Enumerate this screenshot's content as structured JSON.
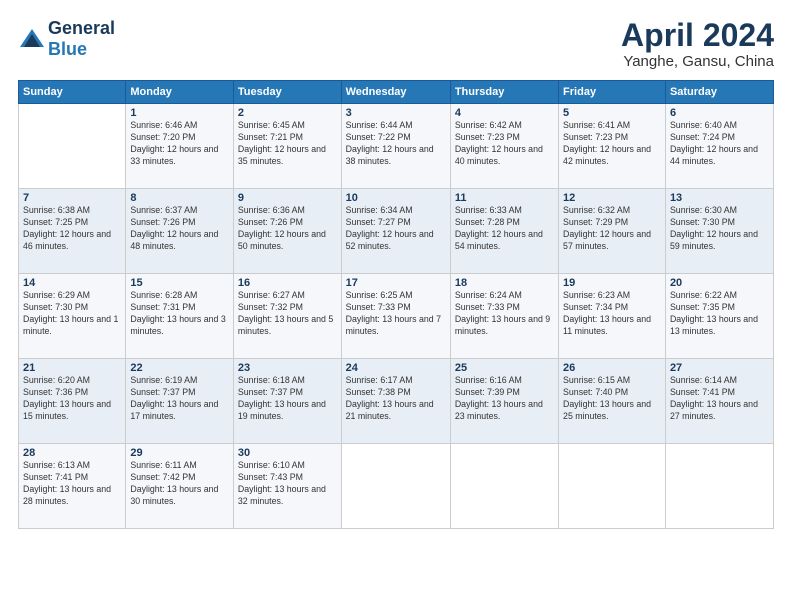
{
  "header": {
    "logo": {
      "general": "General",
      "blue": "Blue"
    },
    "title": "April 2024",
    "location": "Yanghe, Gansu, China"
  },
  "calendar": {
    "days_of_week": [
      "Sunday",
      "Monday",
      "Tuesday",
      "Wednesday",
      "Thursday",
      "Friday",
      "Saturday"
    ],
    "weeks": [
      [
        {
          "day": "",
          "sunrise": "",
          "sunset": "",
          "daylight": ""
        },
        {
          "day": "1",
          "sunrise": "Sunrise: 6:46 AM",
          "sunset": "Sunset: 7:20 PM",
          "daylight": "Daylight: 12 hours and 33 minutes."
        },
        {
          "day": "2",
          "sunrise": "Sunrise: 6:45 AM",
          "sunset": "Sunset: 7:21 PM",
          "daylight": "Daylight: 12 hours and 35 minutes."
        },
        {
          "day": "3",
          "sunrise": "Sunrise: 6:44 AM",
          "sunset": "Sunset: 7:22 PM",
          "daylight": "Daylight: 12 hours and 38 minutes."
        },
        {
          "day": "4",
          "sunrise": "Sunrise: 6:42 AM",
          "sunset": "Sunset: 7:23 PM",
          "daylight": "Daylight: 12 hours and 40 minutes."
        },
        {
          "day": "5",
          "sunrise": "Sunrise: 6:41 AM",
          "sunset": "Sunset: 7:23 PM",
          "daylight": "Daylight: 12 hours and 42 minutes."
        },
        {
          "day": "6",
          "sunrise": "Sunrise: 6:40 AM",
          "sunset": "Sunset: 7:24 PM",
          "daylight": "Daylight: 12 hours and 44 minutes."
        }
      ],
      [
        {
          "day": "7",
          "sunrise": "Sunrise: 6:38 AM",
          "sunset": "Sunset: 7:25 PM",
          "daylight": "Daylight: 12 hours and 46 minutes."
        },
        {
          "day": "8",
          "sunrise": "Sunrise: 6:37 AM",
          "sunset": "Sunset: 7:26 PM",
          "daylight": "Daylight: 12 hours and 48 minutes."
        },
        {
          "day": "9",
          "sunrise": "Sunrise: 6:36 AM",
          "sunset": "Sunset: 7:26 PM",
          "daylight": "Daylight: 12 hours and 50 minutes."
        },
        {
          "day": "10",
          "sunrise": "Sunrise: 6:34 AM",
          "sunset": "Sunset: 7:27 PM",
          "daylight": "Daylight: 12 hours and 52 minutes."
        },
        {
          "day": "11",
          "sunrise": "Sunrise: 6:33 AM",
          "sunset": "Sunset: 7:28 PM",
          "daylight": "Daylight: 12 hours and 54 minutes."
        },
        {
          "day": "12",
          "sunrise": "Sunrise: 6:32 AM",
          "sunset": "Sunset: 7:29 PM",
          "daylight": "Daylight: 12 hours and 57 minutes."
        },
        {
          "day": "13",
          "sunrise": "Sunrise: 6:30 AM",
          "sunset": "Sunset: 7:30 PM",
          "daylight": "Daylight: 12 hours and 59 minutes."
        }
      ],
      [
        {
          "day": "14",
          "sunrise": "Sunrise: 6:29 AM",
          "sunset": "Sunset: 7:30 PM",
          "daylight": "Daylight: 13 hours and 1 minute."
        },
        {
          "day": "15",
          "sunrise": "Sunrise: 6:28 AM",
          "sunset": "Sunset: 7:31 PM",
          "daylight": "Daylight: 13 hours and 3 minutes."
        },
        {
          "day": "16",
          "sunrise": "Sunrise: 6:27 AM",
          "sunset": "Sunset: 7:32 PM",
          "daylight": "Daylight: 13 hours and 5 minutes."
        },
        {
          "day": "17",
          "sunrise": "Sunrise: 6:25 AM",
          "sunset": "Sunset: 7:33 PM",
          "daylight": "Daylight: 13 hours and 7 minutes."
        },
        {
          "day": "18",
          "sunrise": "Sunrise: 6:24 AM",
          "sunset": "Sunset: 7:33 PM",
          "daylight": "Daylight: 13 hours and 9 minutes."
        },
        {
          "day": "19",
          "sunrise": "Sunrise: 6:23 AM",
          "sunset": "Sunset: 7:34 PM",
          "daylight": "Daylight: 13 hours and 11 minutes."
        },
        {
          "day": "20",
          "sunrise": "Sunrise: 6:22 AM",
          "sunset": "Sunset: 7:35 PM",
          "daylight": "Daylight: 13 hours and 13 minutes."
        }
      ],
      [
        {
          "day": "21",
          "sunrise": "Sunrise: 6:20 AM",
          "sunset": "Sunset: 7:36 PM",
          "daylight": "Daylight: 13 hours and 15 minutes."
        },
        {
          "day": "22",
          "sunrise": "Sunrise: 6:19 AM",
          "sunset": "Sunset: 7:37 PM",
          "daylight": "Daylight: 13 hours and 17 minutes."
        },
        {
          "day": "23",
          "sunrise": "Sunrise: 6:18 AM",
          "sunset": "Sunset: 7:37 PM",
          "daylight": "Daylight: 13 hours and 19 minutes."
        },
        {
          "day": "24",
          "sunrise": "Sunrise: 6:17 AM",
          "sunset": "Sunset: 7:38 PM",
          "daylight": "Daylight: 13 hours and 21 minutes."
        },
        {
          "day": "25",
          "sunrise": "Sunrise: 6:16 AM",
          "sunset": "Sunset: 7:39 PM",
          "daylight": "Daylight: 13 hours and 23 minutes."
        },
        {
          "day": "26",
          "sunrise": "Sunrise: 6:15 AM",
          "sunset": "Sunset: 7:40 PM",
          "daylight": "Daylight: 13 hours and 25 minutes."
        },
        {
          "day": "27",
          "sunrise": "Sunrise: 6:14 AM",
          "sunset": "Sunset: 7:41 PM",
          "daylight": "Daylight: 13 hours and 27 minutes."
        }
      ],
      [
        {
          "day": "28",
          "sunrise": "Sunrise: 6:13 AM",
          "sunset": "Sunset: 7:41 PM",
          "daylight": "Daylight: 13 hours and 28 minutes."
        },
        {
          "day": "29",
          "sunrise": "Sunrise: 6:11 AM",
          "sunset": "Sunset: 7:42 PM",
          "daylight": "Daylight: 13 hours and 30 minutes."
        },
        {
          "day": "30",
          "sunrise": "Sunrise: 6:10 AM",
          "sunset": "Sunset: 7:43 PM",
          "daylight": "Daylight: 13 hours and 32 minutes."
        },
        {
          "day": "",
          "sunrise": "",
          "sunset": "",
          "daylight": ""
        },
        {
          "day": "",
          "sunrise": "",
          "sunset": "",
          "daylight": ""
        },
        {
          "day": "",
          "sunrise": "",
          "sunset": "",
          "daylight": ""
        },
        {
          "day": "",
          "sunrise": "",
          "sunset": "",
          "daylight": ""
        }
      ]
    ]
  }
}
